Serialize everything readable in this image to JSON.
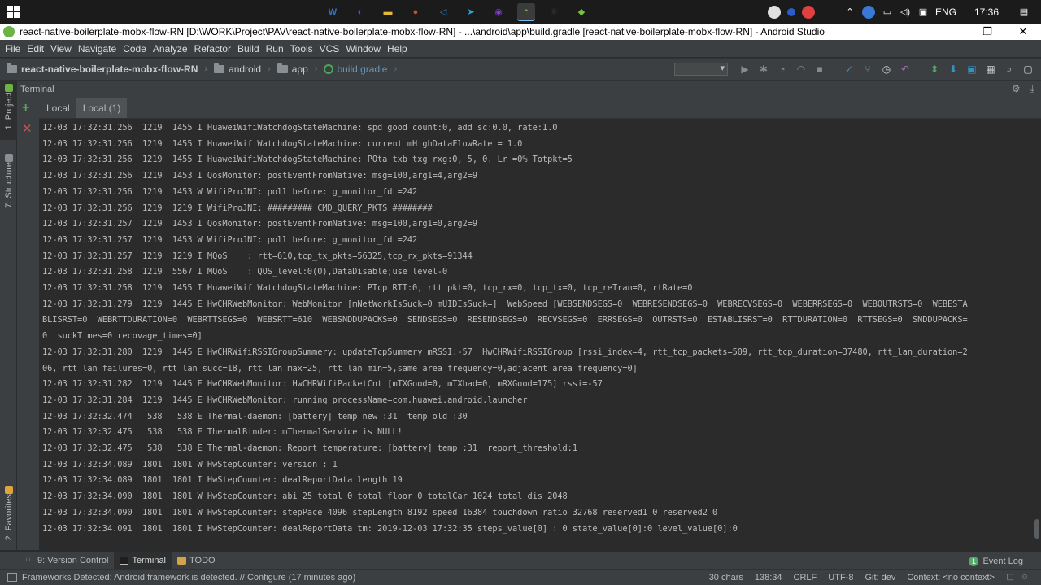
{
  "taskbar": {
    "apps": [
      {
        "icon": "windows-store-icon",
        "color": "#3b6fbf",
        "glyph": "W"
      },
      {
        "icon": "firefox-icon",
        "color": "#1f6fd6",
        "glyph": "◐"
      },
      {
        "icon": "file-explorer-icon",
        "color": "#e5b73b",
        "glyph": "▬"
      },
      {
        "icon": "chrome-icon",
        "color": "#db4437",
        "glyph": "●"
      },
      {
        "icon": "vscode-icon",
        "color": "#2a8ad4",
        "glyph": "◁"
      },
      {
        "icon": "telegram-icon",
        "color": "#2ca5e0",
        "glyph": "➤"
      },
      {
        "icon": "media-player-icon",
        "color": "#7b3fc9",
        "glyph": "◉"
      },
      {
        "icon": "android-studio-icon",
        "color": "#6ab344",
        "glyph": "◓"
      },
      {
        "icon": "react-icon",
        "color": "#444444",
        "glyph": "⚛"
      },
      {
        "icon": "git-app-icon",
        "color": "#79c23f",
        "glyph": "◆"
      }
    ],
    "tray": {
      "language": "ENG",
      "time": "17:36"
    }
  },
  "titlebar": {
    "text": "react-native-boilerplate-mobx-flow-RN [D:\\WORK\\Project\\PAV\\react-native-boilerplate-mobx-flow-RN] - ...\\android\\app\\build.gradle [react-native-boilerplate-mobx-flow-RN] - Android Studio",
    "minimize": "—",
    "restore": "❐",
    "close": "✕"
  },
  "menu": [
    "File",
    "Edit",
    "View",
    "Navigate",
    "Code",
    "Analyze",
    "Refactor",
    "Build",
    "Run",
    "Tools",
    "VCS",
    "Window",
    "Help"
  ],
  "breadcrumb": {
    "project": "react-native-boilerplate-mobx-flow-RN",
    "folder1": "android",
    "folder2": "app",
    "file": "build.gradle"
  },
  "terminal": {
    "title": "Terminal",
    "tabs": [
      "Local",
      "Local (1)"
    ],
    "active_tab": 1,
    "lines": [
      "12-03 17:32:31.256  1219  1455 I HuaweiWifiWatchdogStateMachine: spd good count:0, add sc:0.0, rate:1.0",
      "12-03 17:32:31.256  1219  1455 I HuaweiWifiWatchdogStateMachine: current mHighDataFlowRate = 1.0",
      "12-03 17:32:31.256  1219  1455 I HuaweiWifiWatchdogStateMachine: POta txb txg rxg:0, 5, 0. Lr =0% Totpkt=5",
      "12-03 17:32:31.256  1219  1453 I QosMonitor: postEventFromNative: msg=100,arg1=4,arg2=9",
      "12-03 17:32:31.256  1219  1453 W WifiProJNI: poll before: g_monitor_fd =242",
      "12-03 17:32:31.256  1219  1219 I WifiProJNI: ######### CMD_QUERY_PKTS ########",
      "12-03 17:32:31.257  1219  1453 I QosMonitor: postEventFromNative: msg=100,arg1=0,arg2=9",
      "12-03 17:32:31.257  1219  1453 W WifiProJNI: poll before: g_monitor_fd =242",
      "12-03 17:32:31.257  1219  1219 I MQoS    : rtt=610,tcp_tx_pkts=56325,tcp_rx_pkts=91344",
      "12-03 17:32:31.258  1219  5567 I MQoS    : QOS_level:0(0),DataDisable;use level-0",
      "12-03 17:32:31.258  1219  1455 I HuaweiWifiWatchdogStateMachine: PTcp RTT:0, rtt pkt=0, tcp_rx=0, tcp_tx=0, tcp_reTran=0, rtRate=0",
      "12-03 17:32:31.279  1219  1445 E HwCHRWebMonitor: WebMonitor [mNetWorkIsSuck=0 mUIDIsSuck=]  WebSpeed [WEBSENDSEGS=0  WEBRESENDSEGS=0  WEBRECVSEGS=0  WEBERRSEGS=0  WEBOUTRSTS=0  WEBESTA",
      "BLISRST=0  WEBRTTDURATION=0  WEBRTTSEGS=0  WEBSRTT=610  WEBSNDDUPACKS=0  SENDSEGS=0  RESENDSEGS=0  RECVSEGS=0  ERRSEGS=0  OUTRSTS=0  ESTABLISRST=0  RTTDURATION=0  RTTSEGS=0  SNDDUPACKS=",
      "0  suckTimes=0 recovage_times=0]",
      "12-03 17:32:31.280  1219  1445 E HwCHRWifiRSSIGroupSummery: updateTcpSummery mRSSI:-57  HwCHRWifiRSSIGroup [rssi_index=4, rtt_tcp_packets=509, rtt_tcp_duration=37480, rtt_lan_duration=2",
      "06, rtt_lan_failures=0, rtt_lan_succ=18, rtt_lan_max=25, rtt_lan_min=5,same_area_frequency=0,adjacent_area_frequency=0]",
      "12-03 17:32:31.282  1219  1445 E HwCHRWebMonitor: HwCHRWifiPacketCnt [mTXGood=0, mTXbad=0, mRXGood=175] rssi=-57",
      "12-03 17:32:31.284  1219  1445 E HwCHRWebMonitor: running processName=com.huawei.android.launcher",
      "12-03 17:32:32.474   538   538 E Thermal-daemon: [battery] temp_new :31  temp_old :30",
      "12-03 17:32:32.475   538   538 E ThermalBinder: mThermalService is NULL!",
      "12-03 17:32:32.475   538   538 E Thermal-daemon: Report temperature: [battery] temp :31  report_threshold:1",
      "12-03 17:32:34.089  1801  1801 W HwStepCounter: version : 1",
      "12-03 17:32:34.089  1801  1801 I HwStepCounter: dealReportData length 19",
      "12-03 17:32:34.090  1801  1801 W HwStepCounter: abi 25 total 0 total floor 0 totalCar 1024 total dis 2048",
      "12-03 17:32:34.090  1801  1801 W HwStepCounter: stepPace 4096 stepLength 8192 speed 16384 touchdown_ratio 32768 reserved1 0 reserved2 0",
      "12-03 17:32:34.091  1801  1801 I HwStepCounter: dealReportData tm: 2019-12-03 17:32:35 steps_value[0] : 0 state_value[0]:0 level_value[0]:0"
    ]
  },
  "left_tabs": {
    "project": "1: Project",
    "structure": "7: Structure",
    "favorites": "2: Favorites"
  },
  "bottom_tabs": {
    "version_control": "9: Version Control",
    "terminal": "Terminal",
    "todo": "TODO",
    "event_log": "Event Log"
  },
  "status": {
    "message": "Frameworks Detected: Android framework is detected. // Configure (17 minutes ago)",
    "chars": "30 chars",
    "position": "138:34",
    "line_sep": "CRLF",
    "encoding": "UTF-8",
    "git": "Git: dev",
    "context": "Context: <no context>"
  }
}
